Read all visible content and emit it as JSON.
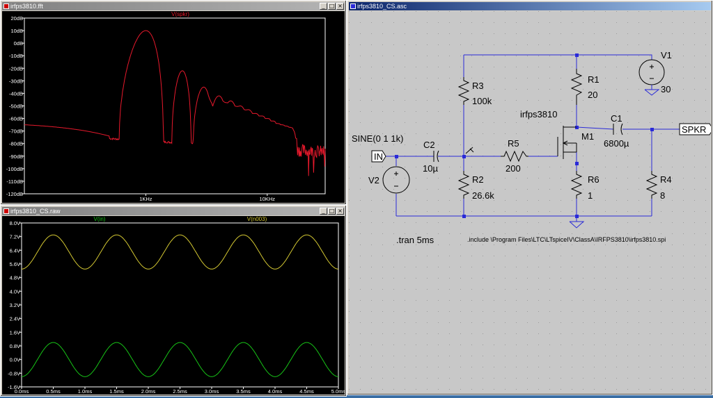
{
  "windows": {
    "fft": {
      "title": "irfps3810.fft"
    },
    "raw": {
      "title": "irfps3810_CS.raw"
    },
    "schematic": {
      "title": "irfps3810_CS.asc"
    }
  },
  "fft_plot": {
    "trace_label": "V(spkr)",
    "trace_color": "#e8192c",
    "y_ticks": [
      "20dB",
      "10dB",
      "0dB",
      "-10dB",
      "-20dB",
      "-30dB",
      "-40dB",
      "-50dB",
      "-60dB",
      "-70dB",
      "-80dB",
      "-90dB",
      "-100dB",
      "-110dB",
      "-120dB"
    ],
    "x_ticks": [
      "1KHz",
      "10KHz"
    ]
  },
  "transient_plot": {
    "trace1_label": "V(in)",
    "trace1_color": "#17c417",
    "trace2_label": "V(n003)",
    "trace2_color": "#d4c832",
    "y_ticks": [
      "8.0V",
      "7.2V",
      "6.4V",
      "5.6V",
      "4.8V",
      "4.0V",
      "3.2V",
      "2.4V",
      "1.6V",
      "0.8V",
      "0.0V",
      "-0.8V",
      "-1.6V"
    ],
    "x_ticks": [
      "0.0ms",
      "0.5ms",
      "1.0ms",
      "1.5ms",
      "2.0ms",
      "2.5ms",
      "3.0ms",
      "3.5ms",
      "4.0ms",
      "4.5ms",
      "5.0ms"
    ]
  },
  "chart_data": [
    {
      "type": "line",
      "title": "V(spkr)",
      "xlabel": "",
      "ylabel": "",
      "x_scale": "log",
      "ylim": [
        -120,
        20
      ],
      "series": [
        {
          "name": "V(spkr)",
          "harmonics_khz": [
            1,
            2,
            3,
            4,
            5,
            6,
            7,
            8,
            9,
            10,
            11,
            12,
            13,
            14,
            15
          ],
          "harmonic_peaks_db": [
            10,
            -22,
            -35,
            -42,
            -46,
            -50,
            -53,
            -56,
            -58,
            -60,
            -62,
            -64,
            -65,
            -66,
            -67
          ]
        }
      ]
    },
    {
      "type": "line",
      "xlabel": "",
      "ylabel": "",
      "xlim": [
        0,
        5
      ],
      "ylim": [
        -1.6,
        8.0
      ],
      "series": [
        {
          "name": "V(in)",
          "waveform": "sine",
          "offset": 0.0,
          "amplitude": 1.0,
          "frequency_khz": 1
        },
        {
          "name": "V(n003)",
          "waveform": "sine",
          "offset": 6.3,
          "amplitude": 1.0,
          "frequency_khz": 1
        }
      ]
    }
  ],
  "schematic": {
    "wire_color": "#2a2ad8",
    "labels": {
      "v1": "V1",
      "v1_val": "30",
      "r1": "R1",
      "r1_val": "20",
      "r3": "R3",
      "r3_val": "100k",
      "m1_model": "irfps3810",
      "m1": "M1",
      "c1": "C1",
      "c1_val": "6800µ",
      "spkr": "SPKR",
      "sine": "SINE(0 1 1k)",
      "c2": "C2",
      "c2_val": "10µ",
      "r5": "R5",
      "r5_val": "200",
      "in": "IN",
      "v2": "V2",
      "r2": "R2",
      "r2_val": "26.6k",
      "r6": "R6",
      "r6_val": "1",
      "r4": "R4",
      "r4_val": "8",
      "tran": ".tran 5ms",
      "include": ".include \\Program Files\\LTC\\LTspiceIV\\ClassA\\IRFPS3810\\irfps3810.spi"
    }
  }
}
